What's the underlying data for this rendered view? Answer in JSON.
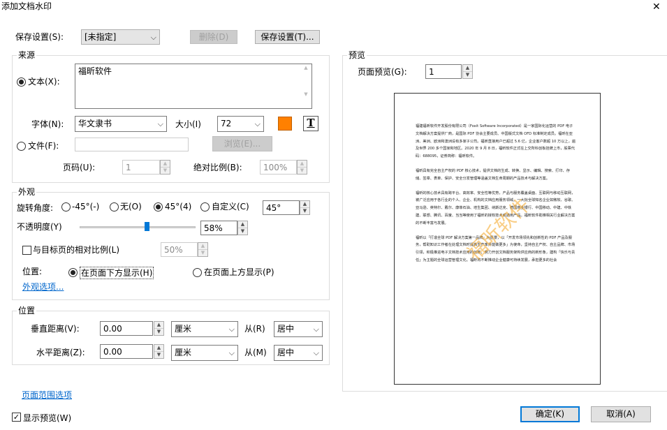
{
  "window": {
    "title": "添加文档水印",
    "close_glyph": "✕"
  },
  "top": {
    "save_settings_label": "保存设置(S):",
    "preset_value": "[未指定]",
    "delete_label": "删除(D)",
    "save_button_label": "保存设置(T)..."
  },
  "source": {
    "group_title": "来源",
    "text_radio_label": "文本(X):",
    "text_value": "福昕软件",
    "font_label": "字体(N):",
    "font_value": "华文隶书",
    "size_label": "大小(I)",
    "size_value": "72",
    "text_color": "#ff8000",
    "text_format_glyph": "T",
    "file_radio_label": "文件(F):",
    "file_value": "",
    "browse_label": "浏览(E)...",
    "page_num_label": "页码(U):",
    "page_num_value": "1",
    "abs_scale_label": "绝对比例(B):",
    "abs_scale_value": "100%"
  },
  "appearance": {
    "group_title": "外观",
    "rotation_label": "旋转角度:",
    "rot_options": [
      "-45°(-)",
      "无(O)",
      "45°(4)",
      "自定义(C)"
    ],
    "rot_custom_value": "45°",
    "opacity_label": "不透明度(Y)",
    "opacity_value": "58%",
    "opacity_fraction": 0.58,
    "relative_scale_label": "与目标页的相对比例(L)",
    "relative_scale_value": "50%",
    "position_label": "位置:",
    "below_label": "在页面下方显示(H)",
    "above_label": "在页面上方显示(P)",
    "more_options_link": "外观选项..."
  },
  "position": {
    "group_title": "位置",
    "vertical_label": "垂直距离(V):",
    "vertical_value": "0.00",
    "vertical_unit": "厘米",
    "from_v_label": "从(R)",
    "from_v_value": "居中",
    "horizontal_label": "水平距离(Z):",
    "horizontal_value": "0.00",
    "horizontal_unit": "厘米",
    "from_h_label": "从(M)",
    "from_h_value": "居中"
  },
  "preview": {
    "group_title": "预览",
    "page_label": "页面预览(G):",
    "page_value": "1",
    "watermark_text": "福昕软件",
    "doc_paragraphs": [
      "福建福昕软件开发股份有限公司（Foxit Software Incorporated）是一家国际化运营的 PDF 电子文档解决方案提供厂商，是国际 PDF 协会主要成员、中国版式文档 OFD 标准制定成员。福昕在亚洲、美洲、欧洲和澳洲设有多家子公司。福昕直接用户已超过 5.6 亿，企业客户数超 10 万以上，遍及世界 200 多个国家和地区。2020 年 9 月 8 日，福昕软件正式在上交所科创板挂牌上市，股票代码：688095，证券简称：福昕软件。",
      "福昕具有完全自主产权的 PDF 核心技术，提供文档的生成、转换、显示、编辑、搜索、打印、存储、签章、表单、保护、安全分发管理等涵盖文档生命周期的产品技术与解决方案。",
      "福昕的核心技术具有跨平台、高效率、安全性等优势，产品与服务覆盖桌面、互联网与移动互联网，被广泛应用于各行业的个人、企业、机构的文档应用服务领域。一大批全球知名企业如微软、谷歌、亚马逊、英特尔、戴尔、康菲石油、培生集团、纳斯达克、德国商业银行、中国移动、中建、中铁建、联想、腾讯、百度、当当等使用了福昕的授权技术或通用产品。福昕软件助推相关行业解决方案的不断丰富与发展。",
      "福昕以「打造全球 PDF 解决方案第一品牌」为愿景，以「开发市场领先和创新性的 PDF 产品及服务，帮助知识工作者在处理文档时提高生产率并能做更多」为使命，坚持自主产权、自主品牌、市场引领，积极推进电子文档技术应用的创新，努力开创文档服务架构供应商的新形象，建构「快乐与责任」为主题的全球运营管理文化。福昕将不断推动企业健康可持续发展，承担更多的社会"
    ]
  },
  "bottom": {
    "page_range_link": "页面范围选项",
    "show_preview_label": "显示预览(W)",
    "show_preview_checked": true,
    "ok_label": "确定(K)",
    "cancel_label": "取消(A)"
  }
}
